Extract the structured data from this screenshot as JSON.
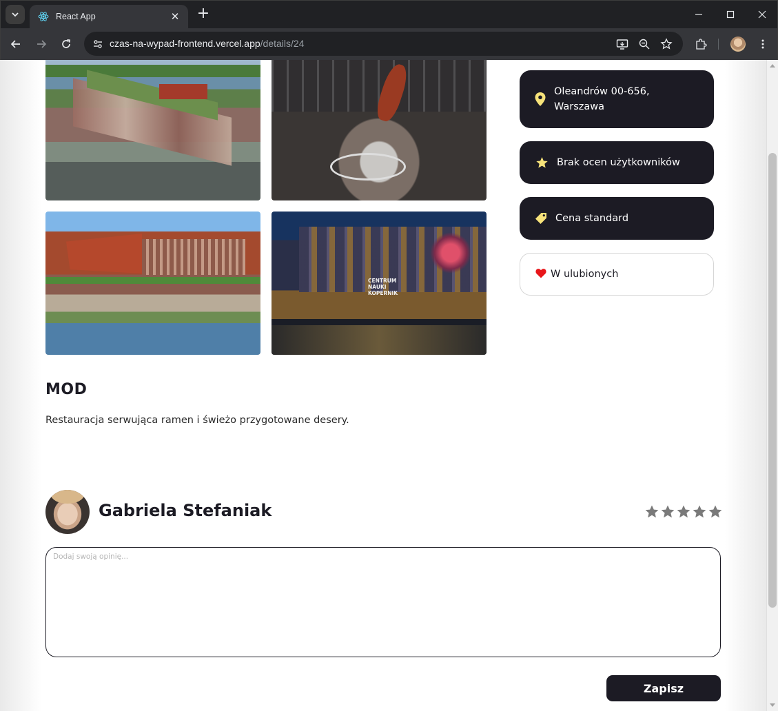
{
  "browser": {
    "tab_title": "React App",
    "url_host": "czas-na-wypad-frontend.vercel.app",
    "url_path": "/details/24"
  },
  "place": {
    "photos": [
      {
        "alt": "photo-1"
      },
      {
        "alt": "photo-2"
      },
      {
        "alt": "photo-3"
      },
      {
        "alt": "photo-4"
      }
    ],
    "photo_4_sign": [
      "CENTRUM",
      "NAUKI",
      "KOPERNIK"
    ],
    "address_line1": "Oleandrów 00-656,",
    "address_line2": "Warszawa",
    "rating_text": "Brak ocen użytkowników",
    "price_text": "Cena standard",
    "favorite_text": "W ulubionych",
    "title": "MOD",
    "description": "Restauracja serwująca ramen i świeżo przygotowane desery."
  },
  "review": {
    "user_name": "Gabriela Stefaniak",
    "stars": 5,
    "stars_filled": 0,
    "placeholder": "Dodaj swoją opinię...",
    "value": "",
    "save_label": "Zapisz"
  },
  "colors": {
    "card_bg": "#1c1b24",
    "icon_yellow": "#f7e37a",
    "heart": "#e8161a",
    "star_empty": "#7a7a7a"
  }
}
